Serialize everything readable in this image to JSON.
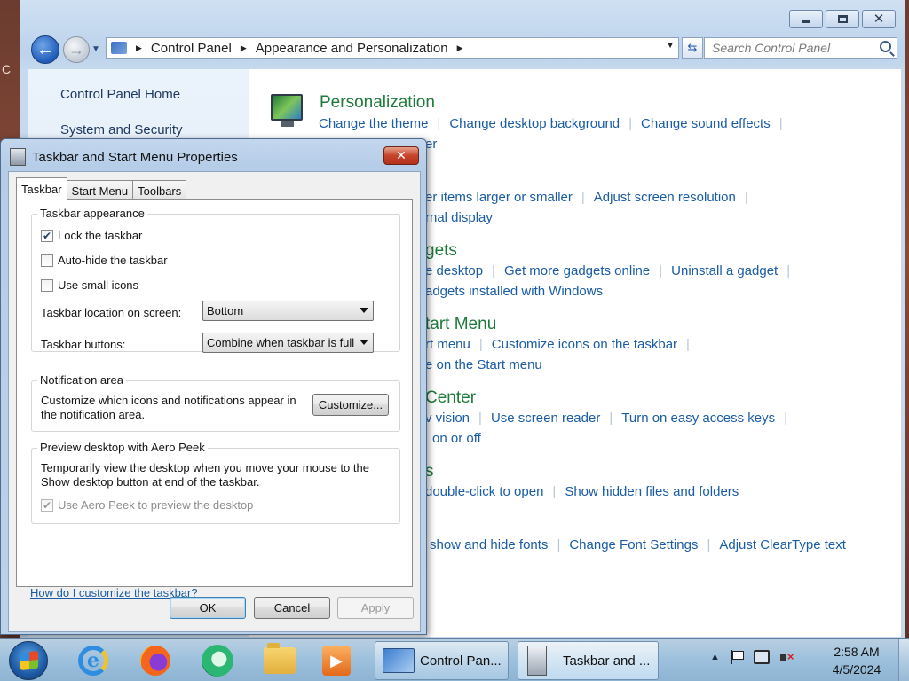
{
  "desktop": {
    "edge_letter": "C"
  },
  "control_panel": {
    "address": {
      "crumbs": [
        "Control Panel",
        "Appearance and Personalization"
      ]
    },
    "search_placeholder": "Search Control Panel",
    "left_nav": {
      "home": "Control Panel Home",
      "system_security": "System and Security"
    },
    "categories": [
      {
        "title": "Personalization",
        "links": [
          "Change the theme",
          "Change desktop background",
          "Change sound effects"
        ],
        "links2": [
          "er"
        ]
      },
      {
        "title": "",
        "links": [
          "er items larger or smaller",
          "Adjust screen resolution"
        ],
        "links2": [
          "rnal display"
        ]
      },
      {
        "title": "gets",
        "links": [
          "e desktop",
          "Get more gadgets online",
          "Uninstall a gadget"
        ],
        "links2": [
          "adgets installed with Windows"
        ]
      },
      {
        "title": "tart Menu",
        "links": [
          "rt menu",
          "Customize icons on the taskbar"
        ],
        "links2": [
          "e on the Start menu"
        ]
      },
      {
        "title": "Center",
        "links": [
          "v vision",
          "Use screen reader",
          "Turn on easy access keys"
        ],
        "links2": [
          "on or off"
        ]
      },
      {
        "title": "s",
        "links": [
          "double-click to open",
          "Show hidden files and folders"
        ]
      },
      {
        "title": "",
        "links": [
          "show and hide fonts",
          "Change Font Settings",
          "Adjust ClearType text"
        ]
      }
    ]
  },
  "dialog": {
    "title": "Taskbar and Start Menu Properties",
    "tabs": [
      "Taskbar",
      "Start Menu",
      "Toolbars"
    ],
    "appearance": {
      "label": "Taskbar appearance",
      "lock": "Lock the taskbar",
      "lock_checked": true,
      "autohide": "Auto-hide the taskbar",
      "small_icons": "Use small icons",
      "location_label": "Taskbar location on screen:",
      "location_value": "Bottom",
      "buttons_label": "Taskbar buttons:",
      "buttons_value": "Combine when taskbar is full"
    },
    "notification": {
      "label": "Notification area",
      "text": "Customize which icons and notifications appear in the notification area.",
      "customize": "Customize..."
    },
    "aero_peek": {
      "label": "Preview desktop with Aero Peek",
      "text": "Temporarily view the desktop when you move your mouse to the Show desktop button at end of the taskbar.",
      "checkbox": "Use Aero Peek to preview the desktop"
    },
    "help_link": "How do I customize the taskbar?",
    "ok": "OK",
    "cancel": "Cancel",
    "apply": "Apply"
  },
  "taskbar": {
    "tasks": [
      {
        "label": "Control Pan..."
      },
      {
        "label": "Taskbar and ..."
      }
    ],
    "time": "2:58 AM",
    "date": "4/5/2024"
  }
}
